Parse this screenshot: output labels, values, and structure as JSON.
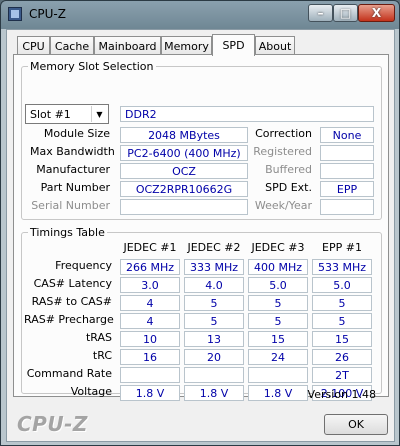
{
  "window": {
    "title": "CPU-Z",
    "minimize": "–",
    "maximize": "□",
    "close": "X"
  },
  "tabs": [
    "CPU",
    "Cache",
    "Mainboard",
    "Memory",
    "SPD",
    "About"
  ],
  "active_tab": "SPD",
  "slot": {
    "group_title": "Memory Slot Selection",
    "selected": "Slot #1",
    "type": "DDR2",
    "labels": {
      "module_size": "Module Size",
      "max_bandwidth": "Max Bandwidth",
      "manufacturer": "Manufacturer",
      "part_number": "Part Number",
      "serial_number": "Serial Number",
      "correction": "Correction",
      "registered": "Registered",
      "buffered": "Buffered",
      "spd_ext": "SPD Ext.",
      "week_year": "Week/Year"
    },
    "values": {
      "module_size": "2048 MBytes",
      "max_bandwidth": "PC2-6400 (400 MHz)",
      "manufacturer": "OCZ",
      "part_number": "OCZ2RPR10662G",
      "serial_number": "",
      "correction": "None",
      "registered": "",
      "buffered": "",
      "spd_ext": "EPP",
      "week_year": ""
    }
  },
  "timings": {
    "group_title": "Timings Table",
    "columns": [
      "JEDEC #1",
      "JEDEC #2",
      "JEDEC #3",
      "EPP #1"
    ],
    "rows": [
      {
        "label": "Frequency",
        "values": [
          "266 MHz",
          "333 MHz",
          "400 MHz",
          "533 MHz"
        ]
      },
      {
        "label": "CAS# Latency",
        "values": [
          "3.0",
          "4.0",
          "5.0",
          "5.0"
        ]
      },
      {
        "label": "RAS# to CAS#",
        "values": [
          "4",
          "5",
          "5",
          "5"
        ]
      },
      {
        "label": "RAS# Precharge",
        "values": [
          "4",
          "5",
          "5",
          "5"
        ]
      },
      {
        "label": "tRAS",
        "values": [
          "10",
          "13",
          "15",
          "15"
        ]
      },
      {
        "label": "tRC",
        "values": [
          "16",
          "20",
          "24",
          "26"
        ]
      },
      {
        "label": "Command Rate",
        "values": [
          "",
          "",
          "",
          "2T"
        ]
      },
      {
        "label": "Voltage",
        "values": [
          "1.8 V",
          "1.8 V",
          "1.8 V",
          "2.100 V"
        ]
      }
    ]
  },
  "footer": {
    "version": "Version 1.48",
    "brand": "CPU-Z",
    "ok_label": "OK"
  }
}
